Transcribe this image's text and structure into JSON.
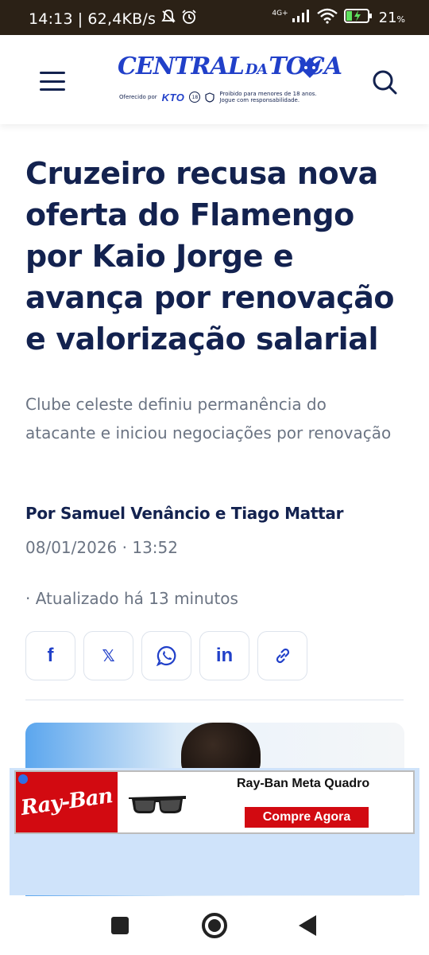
{
  "status_bar": {
    "time": "14:13",
    "speed": "62,4KB/s",
    "network": "4G+",
    "battery": "21",
    "battery_unit": "%"
  },
  "header": {
    "logo_main": "CENTRAL",
    "logo_da": "DA",
    "logo_end": "TOCA",
    "offered_by": "Oferecido por",
    "sponsor": "KTO",
    "age": "18",
    "legal_line1": "Proibido para menores de 18 anos.",
    "legal_line2": "Jogue com responsabilidade."
  },
  "article": {
    "headline": "Cruzeiro recusa nova oferta do Flamengo por Kaio Jorge e avança por renovação e valorização salarial",
    "subtitle": "Clube celeste definiu permanência do atacante e iniciou negociações por renovação",
    "byline": "Por Samuel Venâncio e Tiago Mattar",
    "date": "08/01/2026 · 13:52",
    "updated": "· Atualizado há 13 minutos"
  },
  "share": {
    "facebook": "f",
    "x": "𝕏",
    "linkedin": "in"
  },
  "ad": {
    "brand": "Ray-Ban",
    "title": "Ray-Ban Meta Quadro",
    "cta": "Compre Agora"
  },
  "colors": {
    "brand_blue": "#2140c9",
    "navy": "#13224f",
    "muted": "#6b7483",
    "ad_red": "#d20a11",
    "statusbar": "#2b2116"
  }
}
